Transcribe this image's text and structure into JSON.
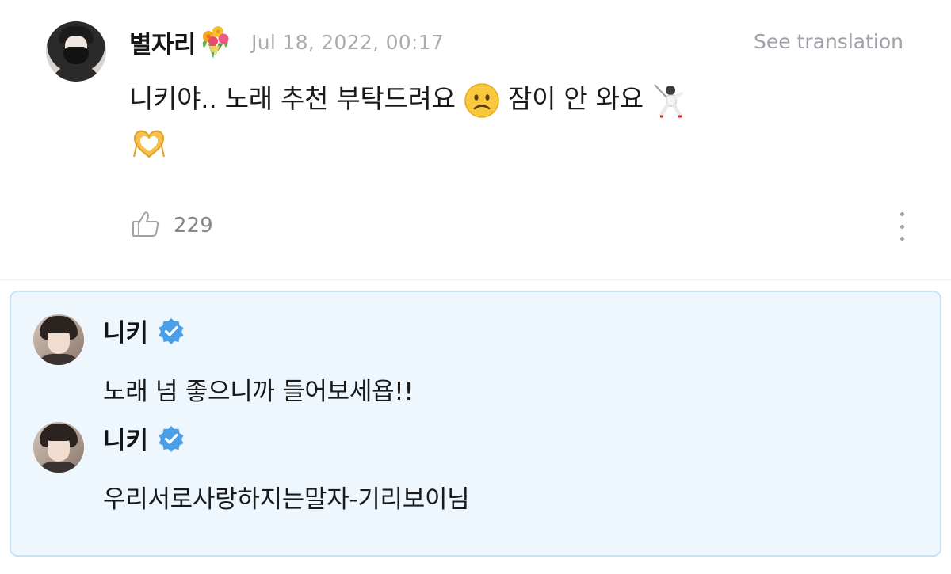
{
  "post": {
    "author_name": "별자리",
    "timestamp": "Jul 18, 2022, 00:17",
    "translate_label": "See translation",
    "text_before_emoji": "니키야.. 노래 추천 부탁드려요",
    "text_after_emoji": "잠이 안 와요",
    "emojis": [
      "bouquet-icon",
      "slightly-frowning-face-emoji",
      "fencer-emoji",
      "heart-hands-emoji"
    ],
    "like_count": "229"
  },
  "replies": [
    {
      "author_name": "니키",
      "verified": true,
      "text": "노래 넘 좋으니까 들어보세욥!!"
    },
    {
      "author_name": "니키",
      "verified": true,
      "text": "우리서로사랑하지는말자-기리보이님"
    }
  ],
  "colors": {
    "reply_background": "#eef7fd",
    "reply_border": "#c9e3f3",
    "verified_badge": "#4a9fe8",
    "muted_text": "#a8acb0"
  }
}
